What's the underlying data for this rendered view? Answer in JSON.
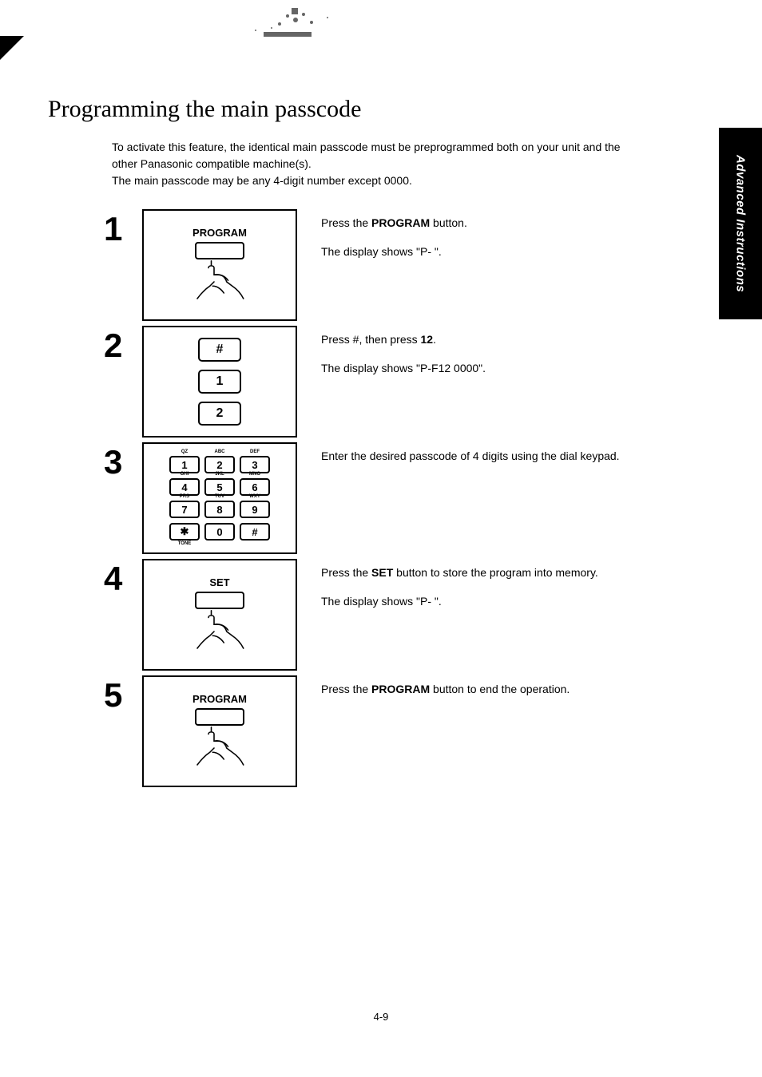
{
  "sidetab": "Advanced Instructions",
  "title": "Programming the main passcode",
  "intro_line1": "To activate this feature, the identical main passcode must be preprogrammed both on your unit and the other Panasonic compatible machine(s).",
  "intro_line2": "The main passcode may be any 4-digit number except 0000.",
  "steps": [
    {
      "num": "1",
      "illus_type": "press",
      "illus_label": "PROGRAM",
      "desc": [
        {
          "parts": [
            {
              "t": "Press the "
            },
            {
              "t": "PROGRAM",
              "b": true
            },
            {
              "t": " button."
            }
          ]
        },
        {
          "parts": [
            {
              "t": "The display shows \"P-  \"."
            }
          ]
        }
      ]
    },
    {
      "num": "2",
      "illus_type": "keystack",
      "keys": [
        "#",
        "1",
        "2"
      ],
      "desc": [
        {
          "parts": [
            {
              "t": "Press #, then press "
            },
            {
              "t": "12",
              "b": true
            },
            {
              "t": "."
            }
          ]
        },
        {
          "parts": [
            {
              "t": "The display shows \"P-F12  0000\"."
            }
          ]
        }
      ]
    },
    {
      "num": "3",
      "illus_type": "keypad",
      "keypad": {
        "rows": [
          [
            {
              "k": "1",
              "top": "QZ"
            },
            {
              "k": "2",
              "top": "ABC"
            },
            {
              "k": "3",
              "top": "DEF"
            }
          ],
          [
            {
              "k": "4",
              "top": "GHI"
            },
            {
              "k": "5",
              "top": "JKL"
            },
            {
              "k": "6",
              "top": "MNO"
            }
          ],
          [
            {
              "k": "7",
              "top": "PRS"
            },
            {
              "k": "8",
              "top": "TUV"
            },
            {
              "k": "9",
              "top": "WXY"
            }
          ],
          [
            {
              "k": "✱",
              "bot": "TONE"
            },
            {
              "k": "0"
            },
            {
              "k": "#"
            }
          ]
        ]
      },
      "desc": [
        {
          "parts": [
            {
              "t": "Enter the desired passcode of 4 digits using the dial keypad."
            }
          ]
        }
      ]
    },
    {
      "num": "4",
      "illus_type": "press",
      "illus_label": "SET",
      "desc": [
        {
          "parts": [
            {
              "t": "Press the "
            },
            {
              "t": "SET",
              "b": true
            },
            {
              "t": " button to store the program into memory."
            }
          ]
        },
        {
          "parts": [
            {
              "t": "The display shows \"P-  \"."
            }
          ]
        }
      ]
    },
    {
      "num": "5",
      "illus_type": "press",
      "illus_label": "PROGRAM",
      "desc": [
        {
          "parts": [
            {
              "t": "Press the "
            },
            {
              "t": "PROGRAM",
              "b": true
            },
            {
              "t": " button to end the operation."
            }
          ]
        }
      ]
    }
  ],
  "page_number": "4-9"
}
